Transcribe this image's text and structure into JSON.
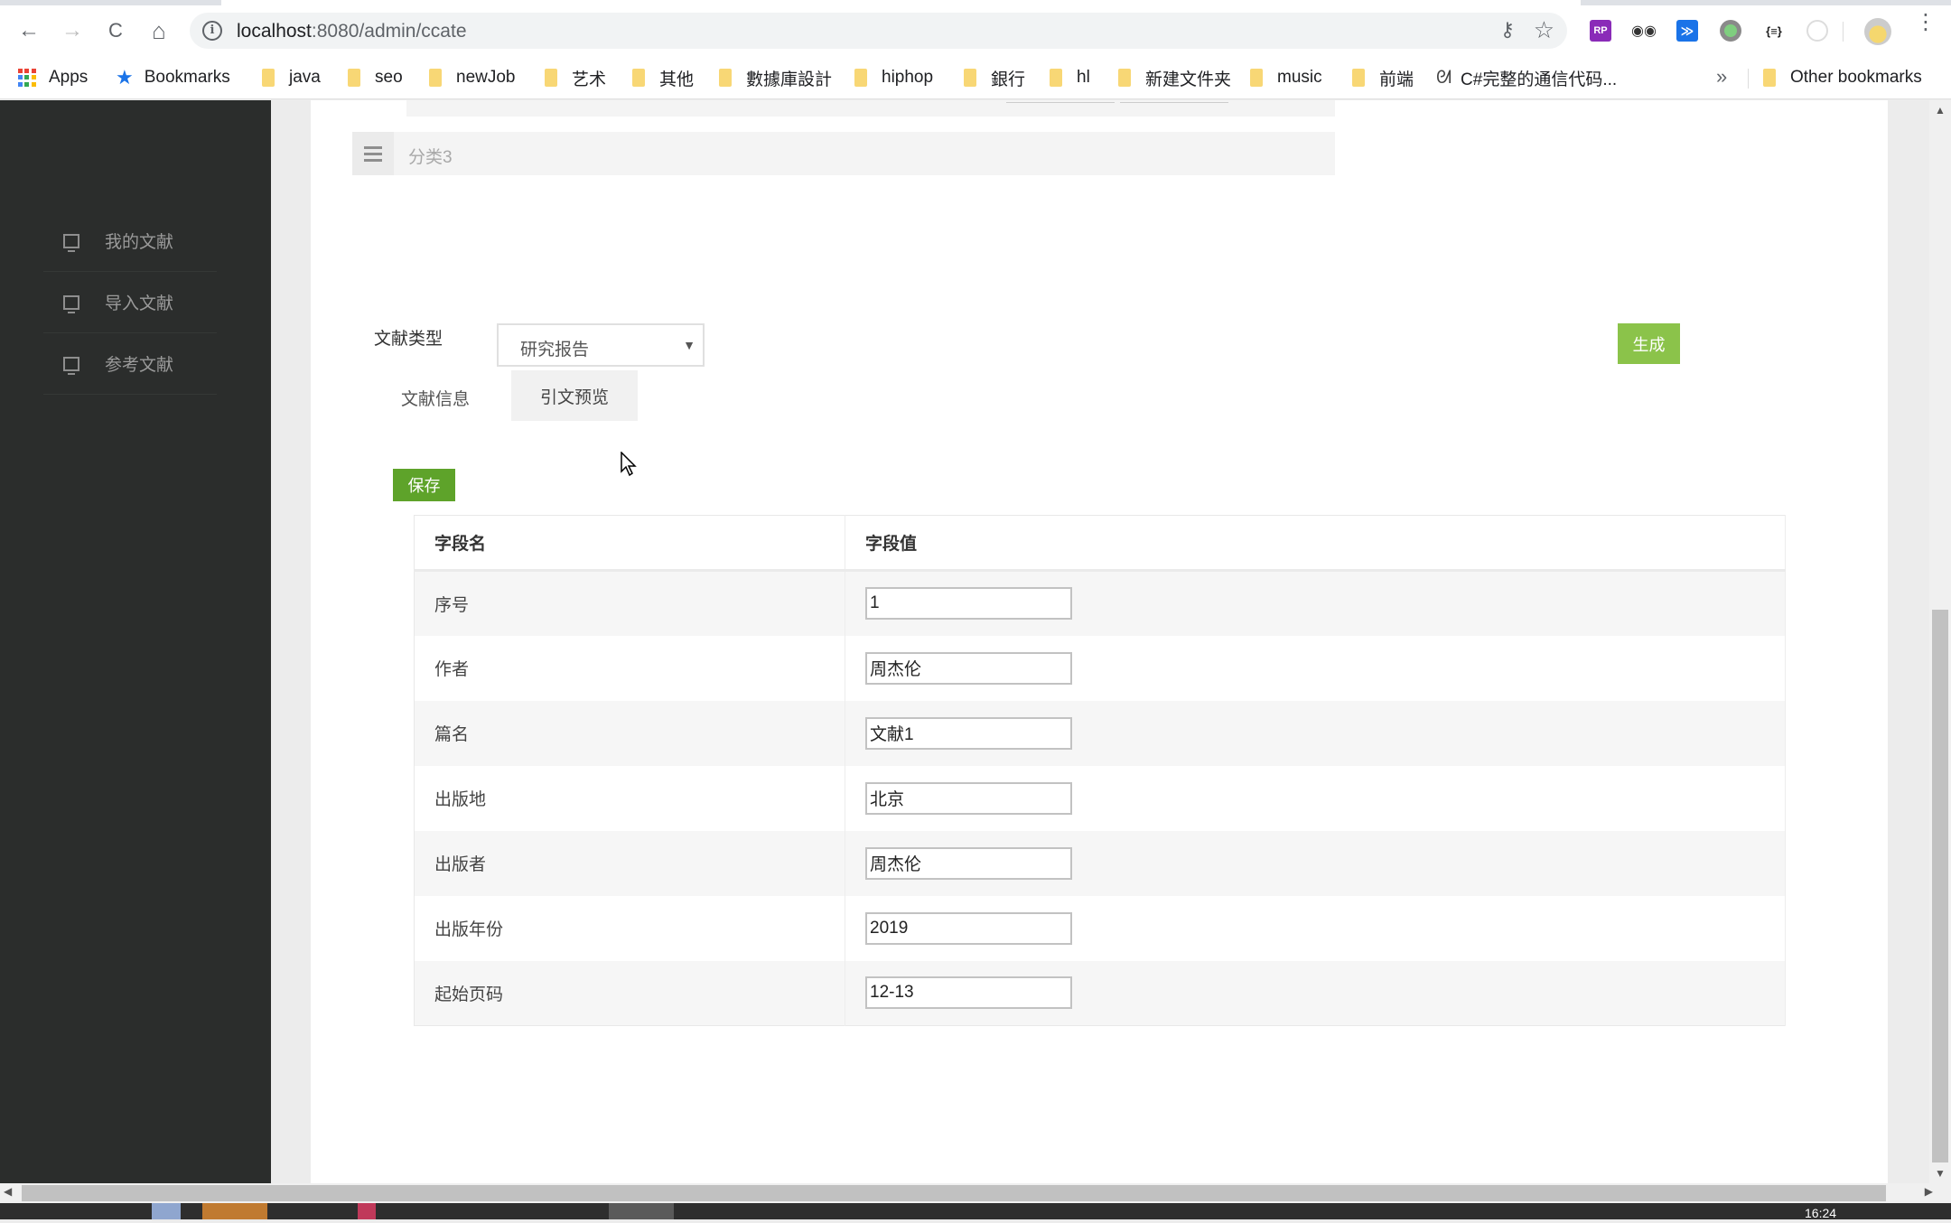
{
  "browser": {
    "url_host": "localhost",
    "url_rest": ":8080/admin/ccate",
    "nav": {
      "back": "←",
      "forward": "→",
      "reload": "C",
      "home": "⌂"
    },
    "extensions": [
      "RP",
      "◉◉",
      "≫",
      "",
      "{≡}",
      ""
    ],
    "bookmarks": [
      {
        "label": "Apps",
        "type": "apps"
      },
      {
        "label": "Bookmarks",
        "type": "star"
      },
      {
        "label": "java",
        "type": "folder"
      },
      {
        "label": "seo",
        "type": "folder"
      },
      {
        "label": "newJob",
        "type": "folder"
      },
      {
        "label": "艺术",
        "type": "folder"
      },
      {
        "label": "其他",
        "type": "folder"
      },
      {
        "label": "數據庫設計",
        "type": "folder"
      },
      {
        "label": "hiphop",
        "type": "folder"
      },
      {
        "label": "銀行",
        "type": "folder"
      },
      {
        "label": "hl",
        "type": "folder"
      },
      {
        "label": "新建文件夹",
        "type": "folder"
      },
      {
        "label": "music",
        "type": "folder"
      },
      {
        "label": "前端",
        "type": "folder"
      },
      {
        "label": "C#完整的通信代码...",
        "type": "page"
      }
    ],
    "more_bookmarks": "»",
    "other_bookmarks": "Other bookmarks"
  },
  "sidebar": {
    "items": [
      {
        "label": "我的文献",
        "icon": "monitor-icon"
      },
      {
        "label": "导入文献",
        "icon": "monitor-icon"
      },
      {
        "label": "参考文献",
        "icon": "monitor-icon"
      }
    ]
  },
  "category": {
    "name": "分类3"
  },
  "form": {
    "type_label": "文献类型",
    "type_value": "研究报告",
    "type_arrow": "▼",
    "generate_label": "生成",
    "tab_info": "文献信息",
    "tab_preview": "引文预览",
    "save_label": "保存",
    "table": {
      "headers": [
        "字段名",
        "字段值"
      ],
      "rows": [
        {
          "name": "序号",
          "value": "1"
        },
        {
          "name": "作者",
          "value": "周杰伦"
        },
        {
          "name": "篇名",
          "value": "文献1"
        },
        {
          "name": "出版地",
          "value": "北京"
        },
        {
          "name": "出版者",
          "value": "周杰伦"
        },
        {
          "name": "出版年份",
          "value": "2019"
        },
        {
          "name": "起始页码",
          "value": "12-13"
        }
      ]
    }
  },
  "taskbar": {
    "clock": "16:24"
  }
}
